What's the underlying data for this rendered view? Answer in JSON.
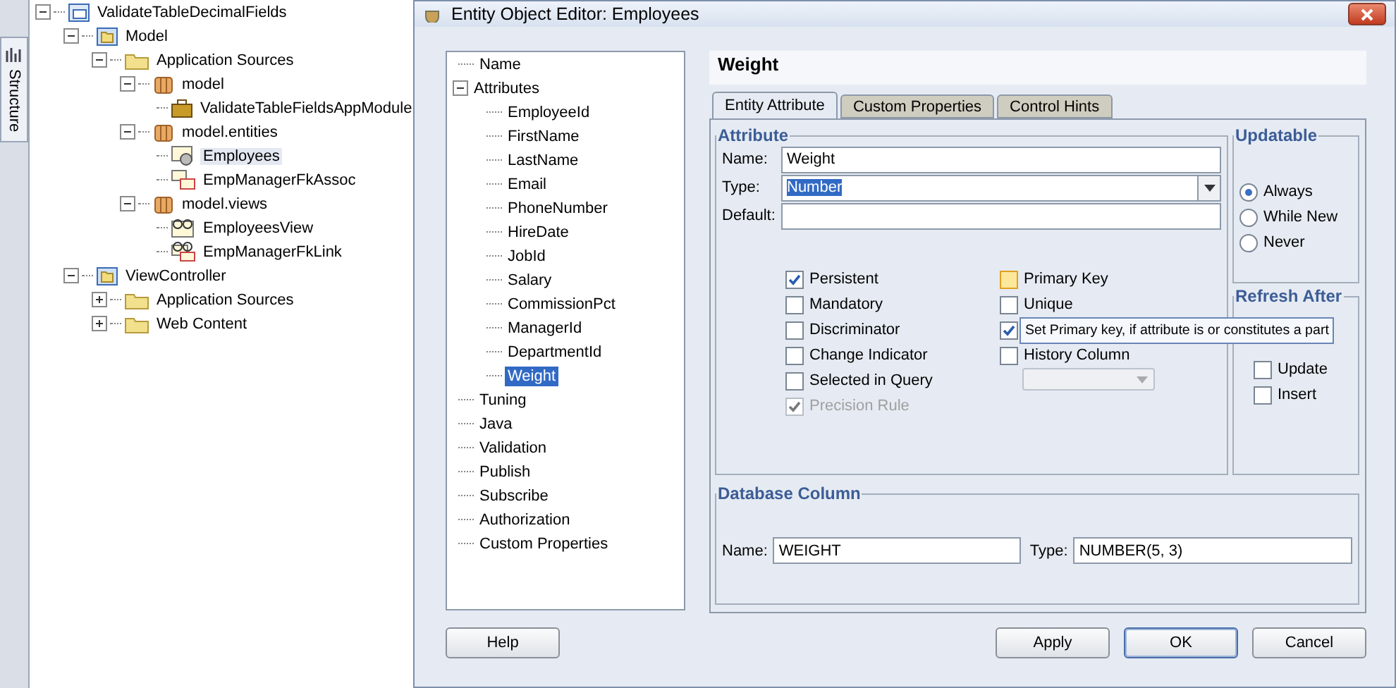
{
  "structure_tab": {
    "label": "Structure"
  },
  "project_tree": [
    {
      "label": "ValidateTableDecimalFields",
      "kind": "workspace",
      "expanded": true,
      "selected": false,
      "children": [
        {
          "label": "Model",
          "kind": "project",
          "expanded": true,
          "selected": false,
          "children": [
            {
              "label": "Application Sources",
              "kind": "folder",
              "expanded": true,
              "selected": false,
              "children": [
                {
                  "label": "model",
                  "kind": "package",
                  "expanded": true,
                  "selected": false,
                  "children": [
                    {
                      "label": "ValidateTableFieldsAppModule",
                      "kind": "appmodule",
                      "selected": false
                    }
                  ]
                },
                {
                  "label": "model.entities",
                  "kind": "package",
                  "expanded": true,
                  "selected": false,
                  "children": [
                    {
                      "label": "Employees",
                      "kind": "entity",
                      "selected": true
                    },
                    {
                      "label": "EmpManagerFkAssoc",
                      "kind": "assoc",
                      "selected": false
                    }
                  ]
                },
                {
                  "label": "model.views",
                  "kind": "package",
                  "expanded": true,
                  "selected": false,
                  "children": [
                    {
                      "label": "EmployeesView",
                      "kind": "view",
                      "selected": false
                    },
                    {
                      "label": "EmpManagerFkLink",
                      "kind": "viewlink",
                      "selected": false
                    }
                  ]
                }
              ]
            }
          ]
        },
        {
          "label": "ViewController",
          "kind": "project",
          "expanded": true,
          "selected": false,
          "children": [
            {
              "label": "Application Sources",
              "kind": "folder",
              "expanded": false,
              "selected": false
            },
            {
              "label": "Web Content",
              "kind": "folder",
              "expanded": false,
              "selected": false
            }
          ]
        }
      ]
    }
  ],
  "dialog": {
    "title": "Entity Object Editor: Employees",
    "nav": [
      {
        "label": "Name",
        "selected": false
      },
      {
        "label": "Attributes",
        "expanded": true,
        "selected": false,
        "children": [
          {
            "label": "EmployeeId",
            "selected": false
          },
          {
            "label": "FirstName",
            "selected": false
          },
          {
            "label": "LastName",
            "selected": false
          },
          {
            "label": "Email",
            "selected": false
          },
          {
            "label": "PhoneNumber",
            "selected": false
          },
          {
            "label": "HireDate",
            "selected": false
          },
          {
            "label": "JobId",
            "selected": false
          },
          {
            "label": "Salary",
            "selected": false
          },
          {
            "label": "CommissionPct",
            "selected": false
          },
          {
            "label": "ManagerId",
            "selected": false
          },
          {
            "label": "DepartmentId",
            "selected": false
          },
          {
            "label": "Weight",
            "selected": true
          }
        ]
      },
      {
        "label": "Tuning",
        "selected": false
      },
      {
        "label": "Java",
        "selected": false
      },
      {
        "label": "Validation",
        "selected": false
      },
      {
        "label": "Publish",
        "selected": false
      },
      {
        "label": "Subscribe",
        "selected": false
      },
      {
        "label": "Authorization",
        "selected": false
      },
      {
        "label": "Custom Properties",
        "selected": false
      }
    ],
    "header": "Weight",
    "tabs": [
      {
        "label": "Entity Attribute",
        "selected": true
      },
      {
        "label": "Custom Properties",
        "selected": false
      },
      {
        "label": "Control Hints",
        "selected": false
      }
    ],
    "attribute": {
      "legend": "Attribute",
      "fields": [
        {
          "label": "Name:",
          "value": "Weight",
          "kind": "text"
        },
        {
          "label": "Type:",
          "value": "Number",
          "kind": "combo"
        },
        {
          "label": "Default:",
          "kind": "text"
        }
      ],
      "options_left": [
        {
          "label": "Persistent",
          "checked": true,
          "disabled": false
        },
        {
          "label": "Mandatory",
          "checked": false,
          "disabled": false
        },
        {
          "label": "Discriminator",
          "checked": false,
          "disabled": false
        },
        {
          "label": "Change Indicator",
          "checked": false,
          "disabled": false
        },
        {
          "label": "Selected in Query",
          "checked": false,
          "disabled": false
        },
        {
          "label": "Precision Rule",
          "checked": true,
          "disabled": true
        }
      ],
      "options_right": [
        {
          "label": "Primary Key",
          "checked": false,
          "focused": true
        },
        {
          "label": "Unique",
          "checked": false,
          "focused": false
        },
        {
          "checked": true,
          "focused": false
        },
        {
          "label": "History Column",
          "checked": false,
          "focused": false
        }
      ],
      "history_dropdown": {
        "disabled": true
      }
    },
    "updatable": {
      "legend": "Updatable",
      "options": [
        {
          "label": "Always",
          "selected": true
        },
        {
          "label": "While New",
          "selected": false
        },
        {
          "label": "Never",
          "selected": false
        }
      ]
    },
    "refresh_after": {
      "legend": "Refresh After",
      "options": [
        {
          "label": "Update",
          "checked": false
        },
        {
          "label": "Insert",
          "checked": false
        }
      ]
    },
    "database_column": {
      "legend": "Database Column",
      "name_label": "Name:",
      "name_value": "WEIGHT",
      "type_label": "Type:",
      "type_value": "NUMBER(5, 3)"
    },
    "tooltip": {
      "text": "Set Primary key, if attribute is or constitutes a part"
    },
    "buttons": [
      {
        "label": "Help",
        "default": false
      },
      {
        "label": "Apply",
        "default": false
      },
      {
        "label": "OK",
        "default": true
      },
      {
        "label": "Cancel",
        "default": false
      }
    ]
  }
}
